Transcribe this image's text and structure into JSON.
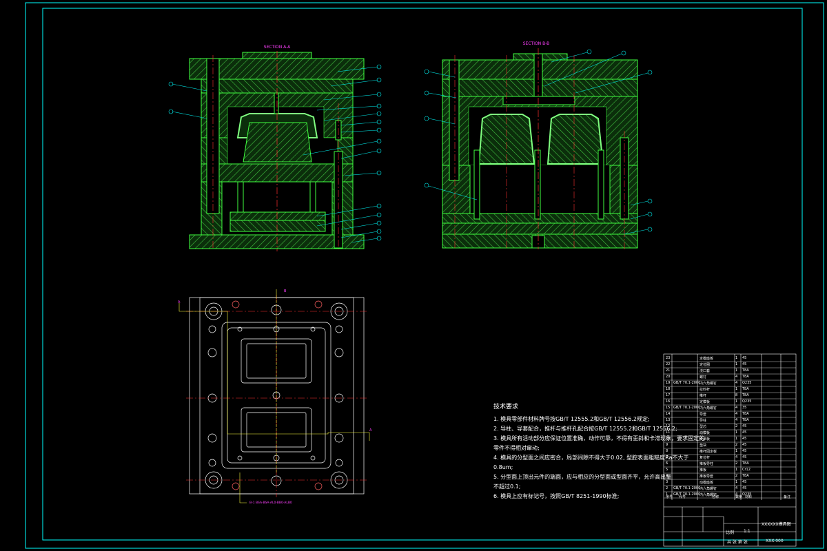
{
  "sections": {
    "left_title": "SECTION A-A",
    "right_title": "SECTION B-B"
  },
  "plan": {
    "cut_label": "B",
    "cut_label_2": "A",
    "bottom_note": "B-1 BSA·BSA·AL0·BB0·ALB0"
  },
  "notes": {
    "title": "技术要求",
    "items": [
      "1. 模具零部件材料牌号按GB/T 12555.2和GB/T 12556.2规定;",
      "2. 导柱、导套配合，推杆与推杆孔配合按GB/T 12555.2和GB/T 12556.2;",
      "3. 模具所有活动部分应保证位置准确，动作可靠，不得有歪斜和卡滞现象，要求固定的",
      "   零件不得相对窜动;",
      "4. 模具的分型面之间应密合，局部间隙不得大于0.02, 型腔表面粗糙度Ra不大于",
      "   0.8um;",
      "5. 分型面上顶出元件的端面，应与相应的分型面或型面齐平，允许高出量",
      "   不超过0.1;",
      "6. 模具上应有标记号，按照GB/T 8251-1990标准;"
    ]
  },
  "title_block": {
    "rows": [
      {
        "no": "23",
        "code": "",
        "name": "定模座板",
        "qty": "1",
        "mat": "45"
      },
      {
        "no": "22",
        "code": "",
        "name": "定位圈",
        "qty": "1",
        "mat": "45"
      },
      {
        "no": "21",
        "code": "",
        "name": "浇口套",
        "qty": "1",
        "mat": "T8A"
      },
      {
        "no": "20",
        "code": "",
        "name": "螺钉",
        "qty": "4",
        "mat": "T8A"
      },
      {
        "no": "19",
        "code": "GB/T 70.1-2000",
        "name": "内六角螺钉",
        "qty": "4",
        "mat": "Q235"
      },
      {
        "no": "18",
        "code": "",
        "name": "拉料杆",
        "qty": "1",
        "mat": "T8A"
      },
      {
        "no": "17",
        "code": "",
        "name": "推杆",
        "qty": "8",
        "mat": "T8A"
      },
      {
        "no": "16",
        "code": "",
        "name": "定模板",
        "qty": "1",
        "mat": "Q235"
      },
      {
        "no": "15",
        "code": "GB/T 70.1-2000",
        "name": "内六角螺钉",
        "qty": "4",
        "mat": "35"
      },
      {
        "no": "14",
        "code": "",
        "name": "导套",
        "qty": "4",
        "mat": "T8A"
      },
      {
        "no": "13",
        "code": "",
        "name": "导柱",
        "qty": "4",
        "mat": "T8A"
      },
      {
        "no": "12",
        "code": "",
        "name": "型芯",
        "qty": "2",
        "mat": "45"
      },
      {
        "no": "11",
        "code": "",
        "name": "动模板",
        "qty": "1",
        "mat": "45"
      },
      {
        "no": "10",
        "code": "",
        "name": "支承板",
        "qty": "1",
        "mat": "45"
      },
      {
        "no": "9",
        "code": "",
        "name": "垫块",
        "qty": "2",
        "mat": "45"
      },
      {
        "no": "8",
        "code": "",
        "name": "推杆固定板",
        "qty": "1",
        "mat": "45"
      },
      {
        "no": "7",
        "code": "",
        "name": "复位杆",
        "qty": "4",
        "mat": "45"
      },
      {
        "no": "6",
        "code": "",
        "name": "推板导柱",
        "qty": "2",
        "mat": "T8A"
      },
      {
        "no": "5",
        "code": "",
        "name": "推板",
        "qty": "1",
        "mat": "Cr12"
      },
      {
        "no": "4",
        "code": "",
        "name": "推板导套",
        "qty": "2",
        "mat": "T8A"
      },
      {
        "no": "3",
        "code": "",
        "name": "动模座板",
        "qty": "1",
        "mat": "45"
      },
      {
        "no": "2",
        "code": "GB/T 70.1-2000",
        "name": "内六角螺钉",
        "qty": "4",
        "mat": "45"
      },
      {
        "no": "1",
        "code": "GB/T 70.1-2000",
        "name": "内六角螺钉",
        "qty": "4",
        "mat": "Q235"
      }
    ],
    "header": {
      "no": "序号",
      "code": "代号",
      "name": "名称",
      "qty": "数量",
      "mat": "材料",
      "note": "备注"
    },
    "drawing_name": "XXXXXX模具图",
    "drawing_no": "XXX-000",
    "scale_label": "比例",
    "scale": "1:1",
    "sheet": "共 张 第 张"
  },
  "colors": {
    "background": "#000000",
    "border": "#00ffff",
    "part_fill": "#0b2e0b",
    "hatch": "#3fbf3f",
    "outline": "#3fff3f",
    "centerline": "#ff3030",
    "leader": "#00e5e5",
    "plan_lines": "#ffffff",
    "highlight": "#ffff40",
    "annotation": "#ff40ff"
  }
}
